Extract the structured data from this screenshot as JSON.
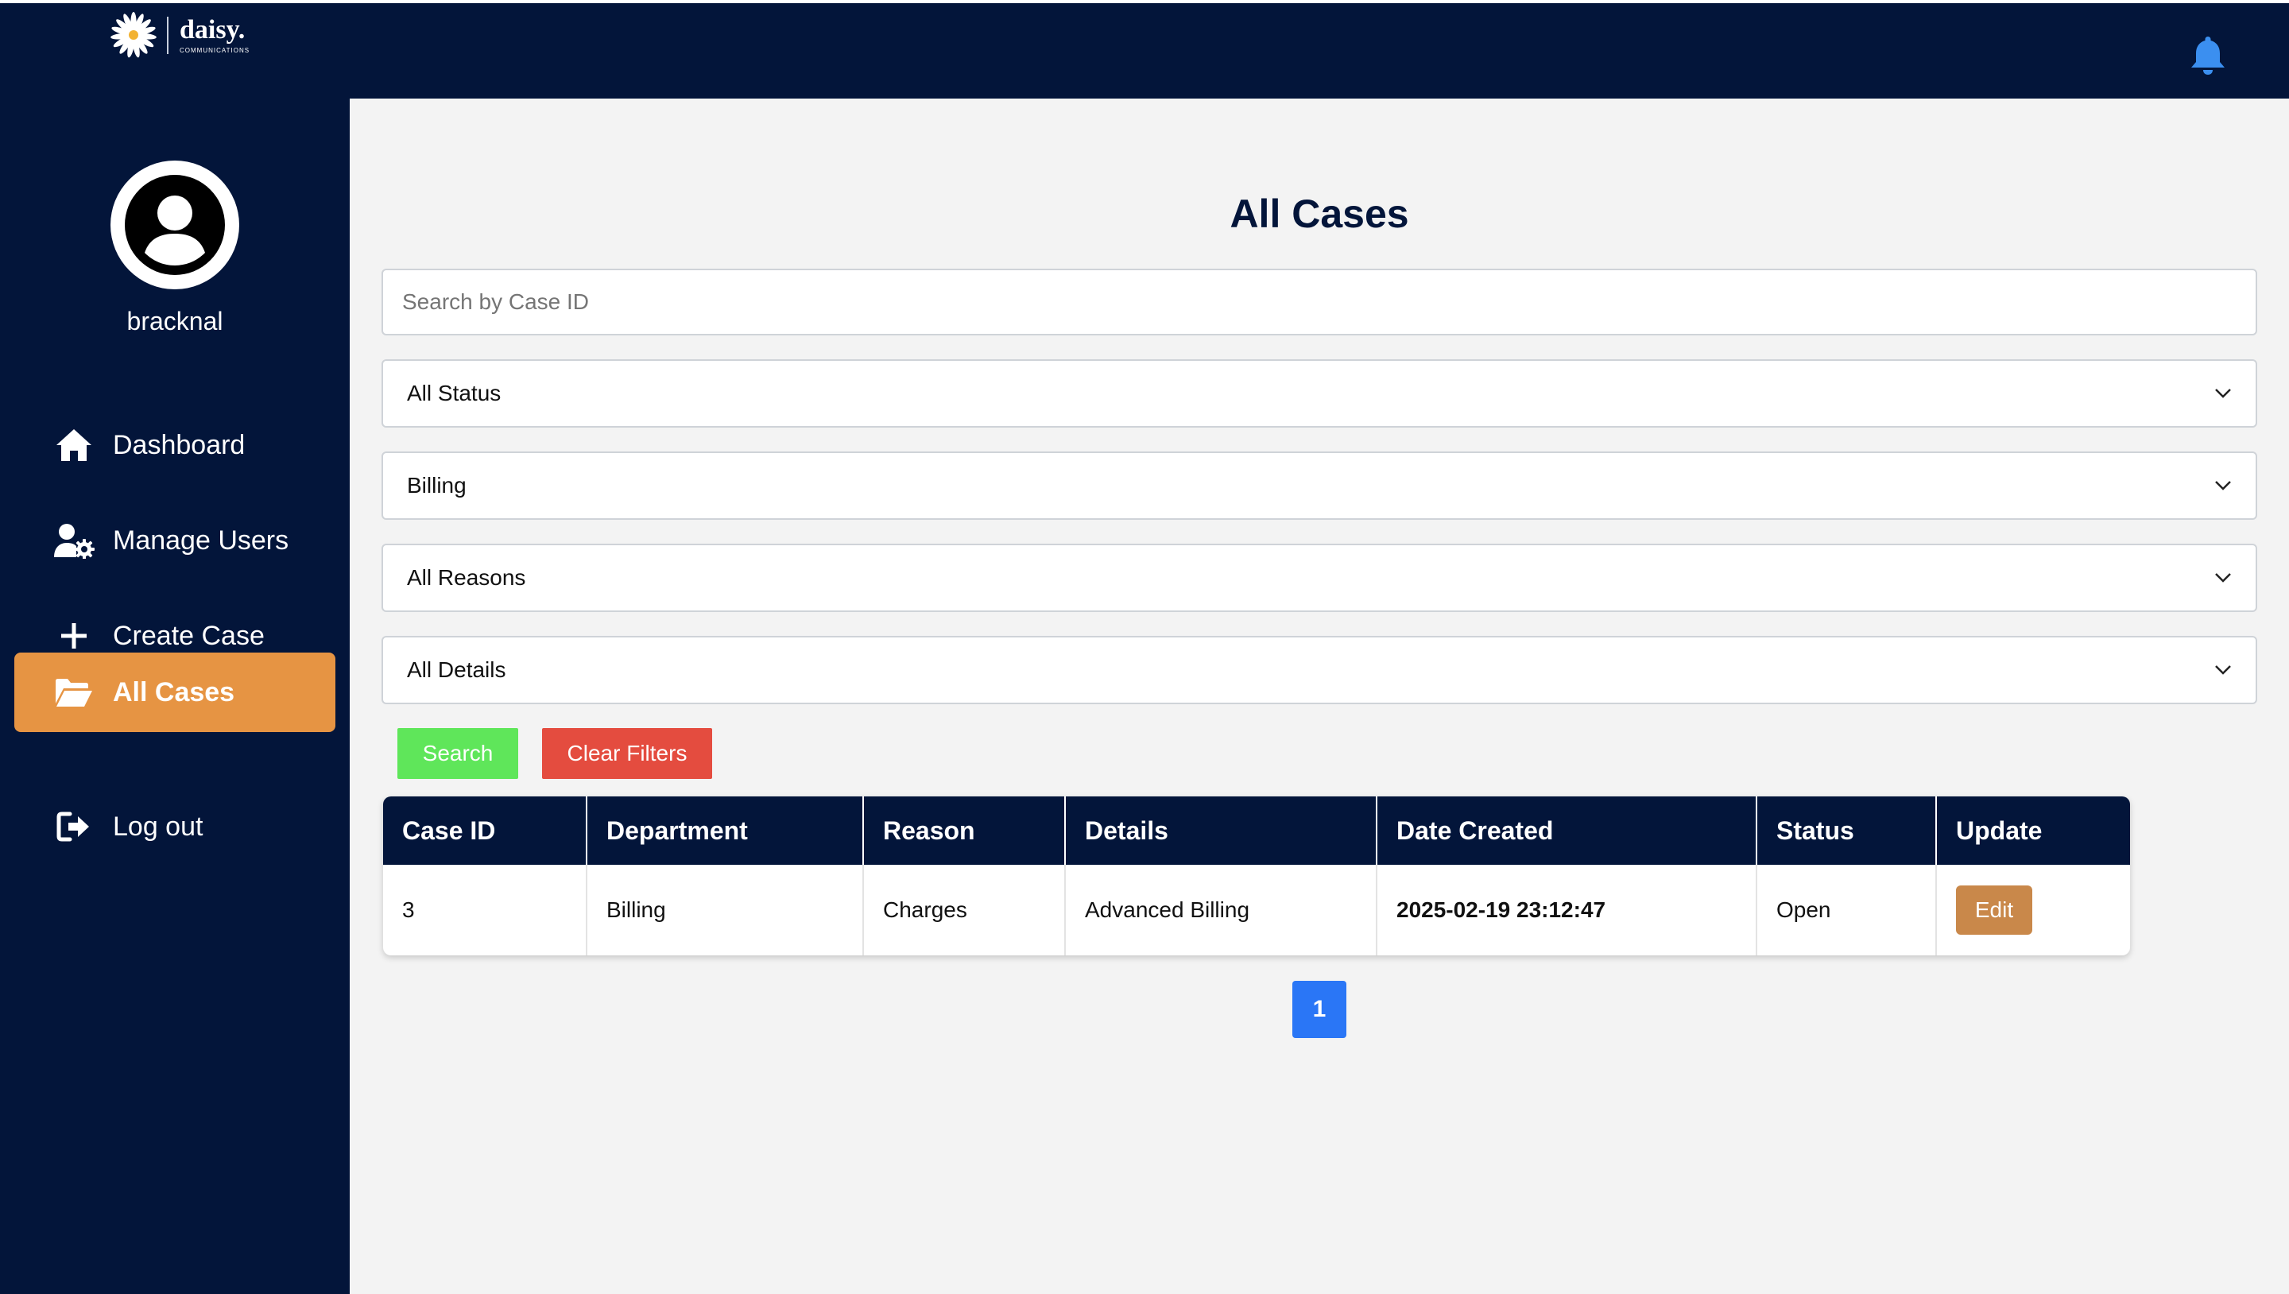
{
  "brand": {
    "name": "daisy.",
    "subtitle": "COMMUNICATIONS",
    "icons": {
      "logo": "daisy-flower-icon",
      "notifications": "bell-icon"
    },
    "colors": {
      "navy": "#03153a",
      "accent": "#e69443",
      "bell": "#3b8ff0"
    }
  },
  "sidebar": {
    "username": "bracknal",
    "items": [
      {
        "label": "Dashboard",
        "icon": "home-icon"
      },
      {
        "label": "Manage Users",
        "icon": "user-gear-icon"
      },
      {
        "label": "Create Case",
        "icon": "plus-icon"
      },
      {
        "label": "All Cases",
        "icon": "folder-open-icon",
        "active": true
      },
      {
        "label": "Log out",
        "icon": "logout-icon"
      }
    ]
  },
  "main": {
    "title": "All Cases",
    "search_placeholder": "Search by Case ID",
    "filters": {
      "status": "All Status",
      "department": "Billing",
      "reason": "All Reasons",
      "details": "All Details"
    },
    "buttons": {
      "search": "Search",
      "clear": "Clear Filters"
    },
    "table": {
      "headers": [
        "Case ID",
        "Department",
        "Reason",
        "Details",
        "Date Created",
        "Status",
        "Update"
      ],
      "rows": [
        {
          "case_id": "3",
          "department": "Billing",
          "reason": "Charges",
          "details": "Advanced Billing",
          "date_created": "2025-02-19 23:12:47",
          "status": "Open",
          "action": "Edit"
        }
      ]
    },
    "pagination": {
      "current": "1"
    }
  }
}
